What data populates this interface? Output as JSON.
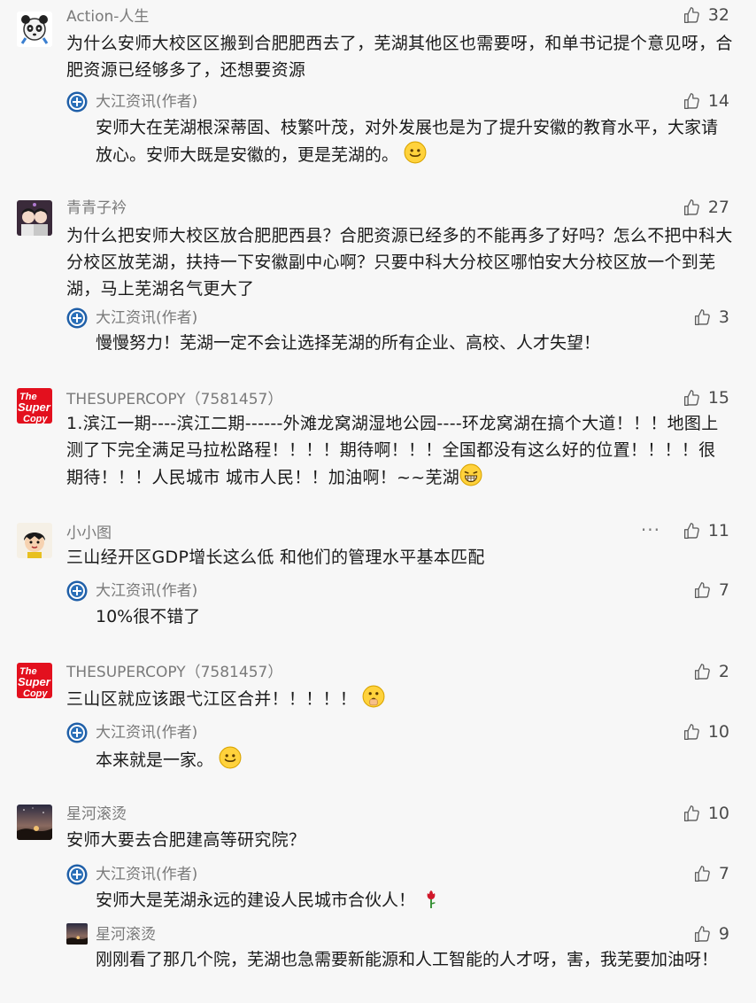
{
  "comments": [
    {
      "nick": "Action-人生",
      "likes": "32",
      "text": "为什么安师大校区区搬到合肥肥西去了，芜湖其他区也需要呀，和单书记提个意见呀，合肥资源已经够多了，还想要资源",
      "replies": [
        {
          "nick": "大江资讯(作者)",
          "likes": "14",
          "text": "安师大在芜湖根深蒂固、枝繁叶茂，对外发展也是为了提升安徽的教育水平，大家请放心。安师大既是安徽的，更是芜湖的。"
        }
      ]
    },
    {
      "nick": "青青子衿",
      "likes": "27",
      "text": "为什么把安师大校区放合肥肥西县？合肥资源已经多的不能再多了好吗？怎么不把中科大分校区放芜湖，扶持一下安徽副中心啊？只要中科大分校区哪怕安大分校区放一个到芜湖，马上芜湖名气更大了",
      "replies": [
        {
          "nick": "大江资讯(作者)",
          "likes": "3",
          "text": "慢慢努力！芜湖一定不会让选择芜湖的所有企业、高校、人才失望！"
        }
      ]
    },
    {
      "nick": "THESUPERCOPY（7581457）",
      "likes": "15",
      "text": "1.滨江一期----滨江二期------外滩龙窝湖湿地公园----环龙窝湖在搞个大道！！！地图上测了下完全满足马拉松路程！！！！期待啊！！！全国都没有这么好的位置！！！！很期待！！！人民城市 城市人民！！加油啊！~~芜湖",
      "replies": []
    },
    {
      "nick": "小小图",
      "likes": "11",
      "more": "···",
      "text": "三山经开区GDP增长这么低 和他们的管理水平基本匹配",
      "replies": [
        {
          "nick": "大江资讯(作者)",
          "likes": "7",
          "text": "10%很不错了"
        }
      ]
    },
    {
      "nick": "THESUPERCOPY（7581457）",
      "likes": "2",
      "text": "三山区就应该跟弋江区合并！！！！！",
      "replies": [
        {
          "nick": "大江资讯(作者)",
          "likes": "10",
          "text": "本来就是一家。"
        }
      ]
    },
    {
      "nick": "星河滚烫",
      "likes": "10",
      "text": "安师大要去合肥建高等研究院？",
      "replies": [
        {
          "nick": "大江资讯(作者)",
          "likes": "7",
          "text": "安师大是芜湖永远的建设人民城市合伙人！"
        },
        {
          "nick": "星河滚烫",
          "likes": "9",
          "text": "刚刚看了那几个院，芜湖也急需要新能源和人工智能的人才呀，害，我芜要加油呀！"
        }
      ]
    }
  ],
  "icons": {
    "like": "thumbs-up-outline",
    "author_badge": "dajiang-logo",
    "smile": "smile-emoji",
    "grin": "grin-emoji",
    "shush": "shush-emoji",
    "rose": "rose-emoji"
  },
  "colors": {
    "background": "#f7f7f7",
    "nick": "#7a7a7a",
    "text": "#1a1a1a",
    "badge": "#1f5fa8"
  }
}
